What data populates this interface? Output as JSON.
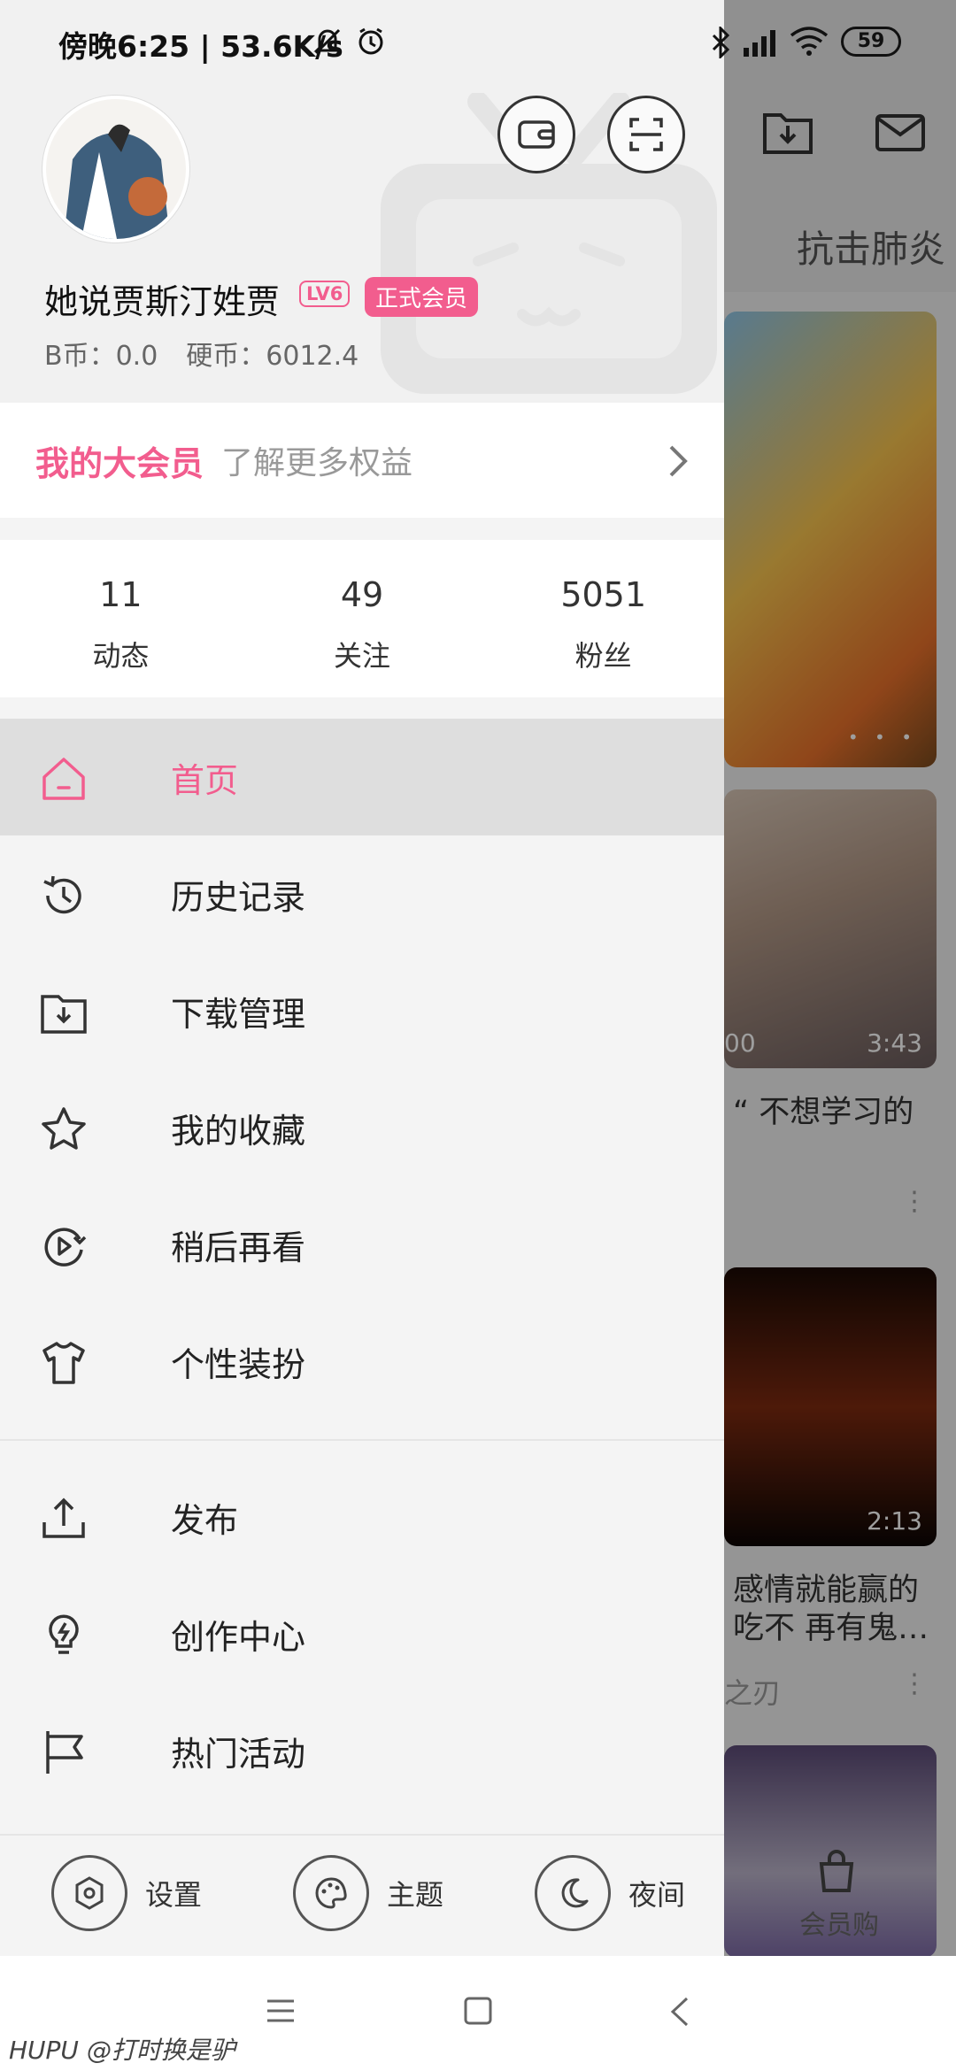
{
  "status_bar": {
    "time_speed": "傍晚6:25 | 53.6K/s",
    "battery": "59"
  },
  "background_app": {
    "tab_label": "抗击肺炎",
    "banner_dots": "• • •",
    "video1": {
      "duration": "3:43",
      "left_badge": "00",
      "title": "“ 不想学习的"
    },
    "video2": {
      "duration": "2:13",
      "title_line1": "感情就能赢的",
      "title_line2": "吃不 再有鬼…",
      "subtitle": "之刃"
    },
    "nav_label": "会员购"
  },
  "profile": {
    "username": "她说贾斯汀姓贾",
    "level": "LV6",
    "vip_badge": "正式会员",
    "b_coins": "B币：0.0",
    "hard_coins": "硬币：6012.4"
  },
  "vip": {
    "title": "我的大会员",
    "subtitle": "了解更多权益"
  },
  "stats": [
    {
      "value": "11",
      "label": "动态"
    },
    {
      "value": "49",
      "label": "关注"
    },
    {
      "value": "5051",
      "label": "粉丝"
    }
  ],
  "menu": [
    {
      "label": "首页",
      "icon": "home-icon",
      "active": true
    },
    {
      "label": "历史记录",
      "icon": "history-icon"
    },
    {
      "label": "下载管理",
      "icon": "download-folder-icon"
    },
    {
      "label": "我的收藏",
      "icon": "star-icon"
    },
    {
      "label": "稍后再看",
      "icon": "watch-later-icon"
    },
    {
      "label": "个性装扮",
      "icon": "tshirt-icon"
    }
  ],
  "menu2": [
    {
      "label": "发布",
      "icon": "upload-icon"
    },
    {
      "label": "创作中心",
      "icon": "lightbulb-icon"
    },
    {
      "label": "热门活动",
      "icon": "flag-icon"
    }
  ],
  "bottom_bar": {
    "settings": "设置",
    "theme": "主题",
    "night": "夜间"
  },
  "watermark": "HUPU @打时换是驴",
  "colors": {
    "accent": "#f25d8e"
  }
}
